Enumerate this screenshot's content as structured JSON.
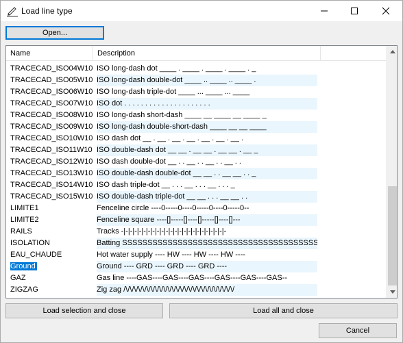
{
  "window": {
    "title": "Load line type",
    "icon": "pen-icon"
  },
  "toolbar": {
    "open_label": "Open..."
  },
  "list": {
    "columns": {
      "name": "Name",
      "description": "Description"
    },
    "rows": [
      {
        "name": "TRACECAD_ISO04W100",
        "description": "ISO long-dash dot ____ . ____ . ____ . ____ . _"
      },
      {
        "name": "TRACECAD_ISO05W100",
        "description": "ISO long-dash double-dot ____ .. ____ .. ____ ."
      },
      {
        "name": "TRACECAD_ISO06W100",
        "description": "ISO long-dash triple-dot ____ ... ____ ... ____"
      },
      {
        "name": "TRACECAD_ISO07W100",
        "description": "ISO dot . . . . . . . . . . . . . . . . . . . . ."
      },
      {
        "name": "TRACECAD_ISO08W100",
        "description": "ISO long-dash short-dash ____ __ ____ __ ____ _"
      },
      {
        "name": "TRACECAD_ISO09W100",
        "description": "ISO long-dash double-short-dash ____ __ __ ____"
      },
      {
        "name": "TRACECAD_ISO10W100",
        "description": "ISO dash dot __ . __ . __ . __ . __ . __ . __ ."
      },
      {
        "name": "TRACECAD_ISO11W100",
        "description": "ISO double-dash dot __ __ . __ __ . __ __ . __ _"
      },
      {
        "name": "TRACECAD_ISO12W100",
        "description": "ISO dash double-dot __ . . __ . . __ . . __ . ."
      },
      {
        "name": "TRACECAD_ISO13W100",
        "description": "ISO double-dash double-dot __ __ . . __ __ . . _"
      },
      {
        "name": "TRACECAD_ISO14W100",
        "description": "ISO dash triple-dot __ . . . __ . . . __ . . . _"
      },
      {
        "name": "TRACECAD_ISO15W100",
        "description": "ISO double-dash triple-dot __ __ . . . __ __ . ."
      },
      {
        "name": "LIMITE1",
        "description": "Fenceline circle ----0-----0----0-----0----0-----0--"
      },
      {
        "name": "LIMITE2",
        "description": "Fenceline square ----[]-----[]----[]-----[]----[]---"
      },
      {
        "name": "RAILS",
        "description": "Tracks -|-|-|-|-|-|-|-|-|-|-|-|-|-|-|-|-|-|-|-|-|-|-|-"
      },
      {
        "name": "ISOLATION",
        "description": "Batting SSSSSSSSSSSSSSSSSSSSSSSSSSSSSSSSSSSSSSSSSSSS"
      },
      {
        "name": "EAU_CHAUDE",
        "description": "Hot water supply ---- HW ---- HW ---- HW ----"
      },
      {
        "name": "Ground",
        "description": "Ground ---- GRD ---- GRD ---- GRD ----",
        "selected": true
      },
      {
        "name": "GAZ",
        "description": "Gas line ----GAS----GAS----GAS----GAS----GAS----GAS--"
      },
      {
        "name": "ZIGZAG",
        "description": "Zig zag /\\/\\/\\/\\/\\/\\/\\/\\/\\/\\/\\/\\/\\/\\/\\/\\/\\/\\/\\/\\/\\/\\/\\/\\/\\/\\/"
      }
    ]
  },
  "buttons": {
    "load_selection": "Load selection and close",
    "load_all": "Load all and close",
    "cancel": "Cancel"
  },
  "colors": {
    "selection": "#0078d7",
    "row_alt": "#eaf6fd"
  }
}
